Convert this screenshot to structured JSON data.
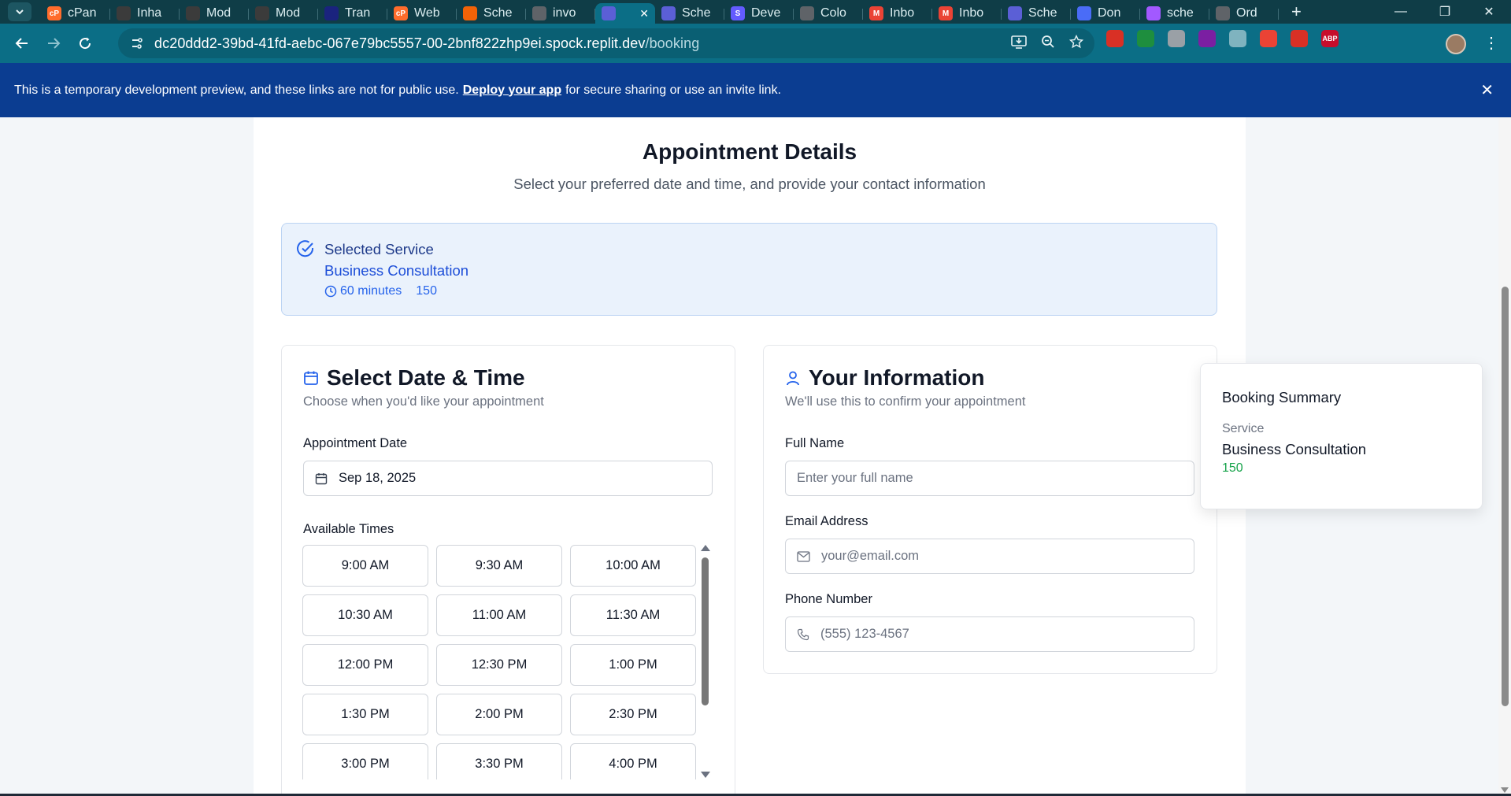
{
  "browser": {
    "tabs": [
      {
        "label": "cPan",
        "icon": "cpanel-icon",
        "color": "#ff6c2c",
        "glyph": "cP"
      },
      {
        "label": "Inha",
        "icon": "film-icon",
        "color": "#3b3b3b",
        "glyph": ""
      },
      {
        "label": "Mod",
        "icon": "film-icon",
        "color": "#3b3b3b",
        "glyph": ""
      },
      {
        "label": "Mod",
        "icon": "film-icon",
        "color": "#3b3b3b",
        "glyph": ""
      },
      {
        "label": "Tran",
        "icon": "translate-icon",
        "color": "#1a237e",
        "glyph": ""
      },
      {
        "label": "Web",
        "icon": "cpanel-icon",
        "color": "#ff6c2c",
        "glyph": "cP"
      },
      {
        "label": "Sche",
        "icon": "pipeline-icon",
        "color": "#f26207",
        "glyph": ""
      },
      {
        "label": "invo",
        "icon": "globe-icon",
        "color": "#5f6368",
        "glyph": ""
      }
    ],
    "active_tab": {
      "label": "",
      "icon": "replit-icon",
      "color": "#5b5fd6"
    },
    "tabs_after": [
      {
        "label": "Sche",
        "icon": "replit-icon",
        "color": "#5b5fd6",
        "glyph": ""
      },
      {
        "label": "Deve",
        "icon": "stripe-icon",
        "color": "#635bff",
        "glyph": "S"
      },
      {
        "label": "Colo",
        "icon": "openai-icon",
        "color": "#5f6368",
        "glyph": ""
      },
      {
        "label": "Inbo",
        "icon": "gmail-icon",
        "color": "#ea4335",
        "glyph": "M"
      },
      {
        "label": "Inbo",
        "icon": "gmail-icon",
        "color": "#ea4335",
        "glyph": "M"
      },
      {
        "label": "Sche",
        "icon": "replit-icon",
        "color": "#5b5fd6",
        "glyph": ""
      },
      {
        "label": "Don",
        "icon": "loader-icon",
        "color": "#4a6cf7",
        "glyph": ""
      },
      {
        "label": "sche",
        "icon": "figma-icon",
        "color": "#a259ff",
        "glyph": ""
      },
      {
        "label": "Ord",
        "icon": "globe-icon",
        "color": "#5f6368",
        "glyph": ""
      }
    ],
    "url_host": "dc20ddd2-39bd-41fd-aebc-067e79bc5557-00-2bnf822zhp9ei.spock.replit.dev",
    "url_path": "/booking",
    "extensions": [
      {
        "name": "ext-red-icon",
        "color": "#d93025",
        "glyph": ""
      },
      {
        "name": "ext-green-icon",
        "color": "#1e8e3e",
        "glyph": ""
      },
      {
        "name": "ext-shield-icon",
        "color": "#9aa0a6",
        "glyph": ""
      },
      {
        "name": "ext-capture-icon",
        "color": "#7b1fa2",
        "glyph": ""
      },
      {
        "name": "ext-wave-icon",
        "color": "#7fb3bf",
        "glyph": ""
      },
      {
        "name": "ext-color-icon",
        "color": "#ea4335",
        "glyph": ""
      },
      {
        "name": "ext-video-icon",
        "color": "#d93025",
        "glyph": ""
      },
      {
        "name": "ext-abp-icon",
        "color": "#c70d2c",
        "glyph": "ABP"
      },
      {
        "name": "extensions-puzzle-icon",
        "color": "#0b6e86",
        "glyph": ""
      }
    ]
  },
  "banner": {
    "text_before": "This is a temporary development preview, and these links are not for public use.",
    "link": "Deploy your app",
    "text_after": "for secure sharing or use an invite link."
  },
  "page": {
    "title": "Appointment Details",
    "subtitle": "Select your preferred date and time, and provide your contact information"
  },
  "service": {
    "label": "Selected Service",
    "name": "Business Consultation",
    "duration": "60 minutes",
    "price": "150"
  },
  "datetime": {
    "title": "Select Date & Time",
    "description": "Choose when you'd like your appointment",
    "date_label": "Appointment Date",
    "date_value": "Sep 18, 2025",
    "times_label": "Available Times",
    "times": [
      "9:00 AM",
      "9:30 AM",
      "10:00 AM",
      "10:30 AM",
      "11:00 AM",
      "11:30 AM",
      "12:00 PM",
      "12:30 PM",
      "1:00 PM",
      "1:30 PM",
      "2:00 PM",
      "2:30 PM",
      "3:00 PM",
      "3:30 PM",
      "4:00 PM"
    ]
  },
  "info": {
    "title": "Your Information",
    "description": "We'll use this to confirm your appointment",
    "name_label": "Full Name",
    "name_placeholder": "Enter your full name",
    "email_label": "Email Address",
    "email_placeholder": "your@email.com",
    "phone_label": "Phone Number",
    "phone_placeholder": "(555) 123-4567"
  },
  "summary": {
    "title": "Booking Summary",
    "service_label": "Service",
    "service_name": "Business Consultation",
    "price": "150"
  },
  "colors": {
    "brand_blue": "#2563eb",
    "price_green": "#16a34a",
    "banner_bg": "#0b3d91",
    "toolbar_bg": "#0b6e86"
  }
}
